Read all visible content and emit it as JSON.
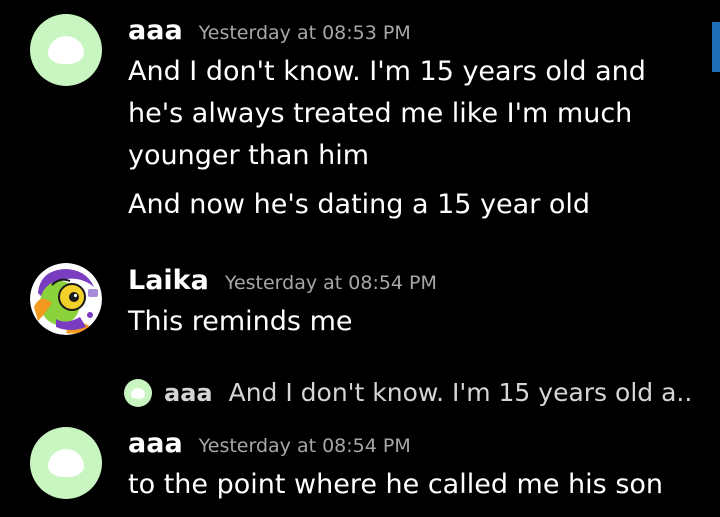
{
  "colors": {
    "background": "#000000",
    "text": "#ffffff",
    "timestamp": "#a7a7ab",
    "default_avatar_bg": "#c8f5c0",
    "scroll_accent": "#1e6fb8"
  },
  "messages": [
    {
      "username": "aaa",
      "timestamp": "Yesterday at 08:53 PM",
      "avatar_icon": "default-blob-avatar",
      "lines": [
        "And I don't know. I'm 15 years old and",
        "he's always treated me like I'm much",
        "younger than him",
        "And now he's dating a 15 year old"
      ]
    },
    {
      "username": "Laika",
      "timestamp": "Yesterday at 08:54 PM",
      "avatar_icon": "cartoon-character-avatar",
      "lines": [
        "This reminds me"
      ]
    },
    {
      "reply_to": {
        "username": "aaa",
        "preview": "And I don't know. I'm 15 years old a..."
      },
      "username": "aaa",
      "timestamp": "Yesterday at 08:54 PM",
      "avatar_icon": "default-blob-avatar",
      "lines": [
        "to the point where he called me his son"
      ]
    }
  ]
}
